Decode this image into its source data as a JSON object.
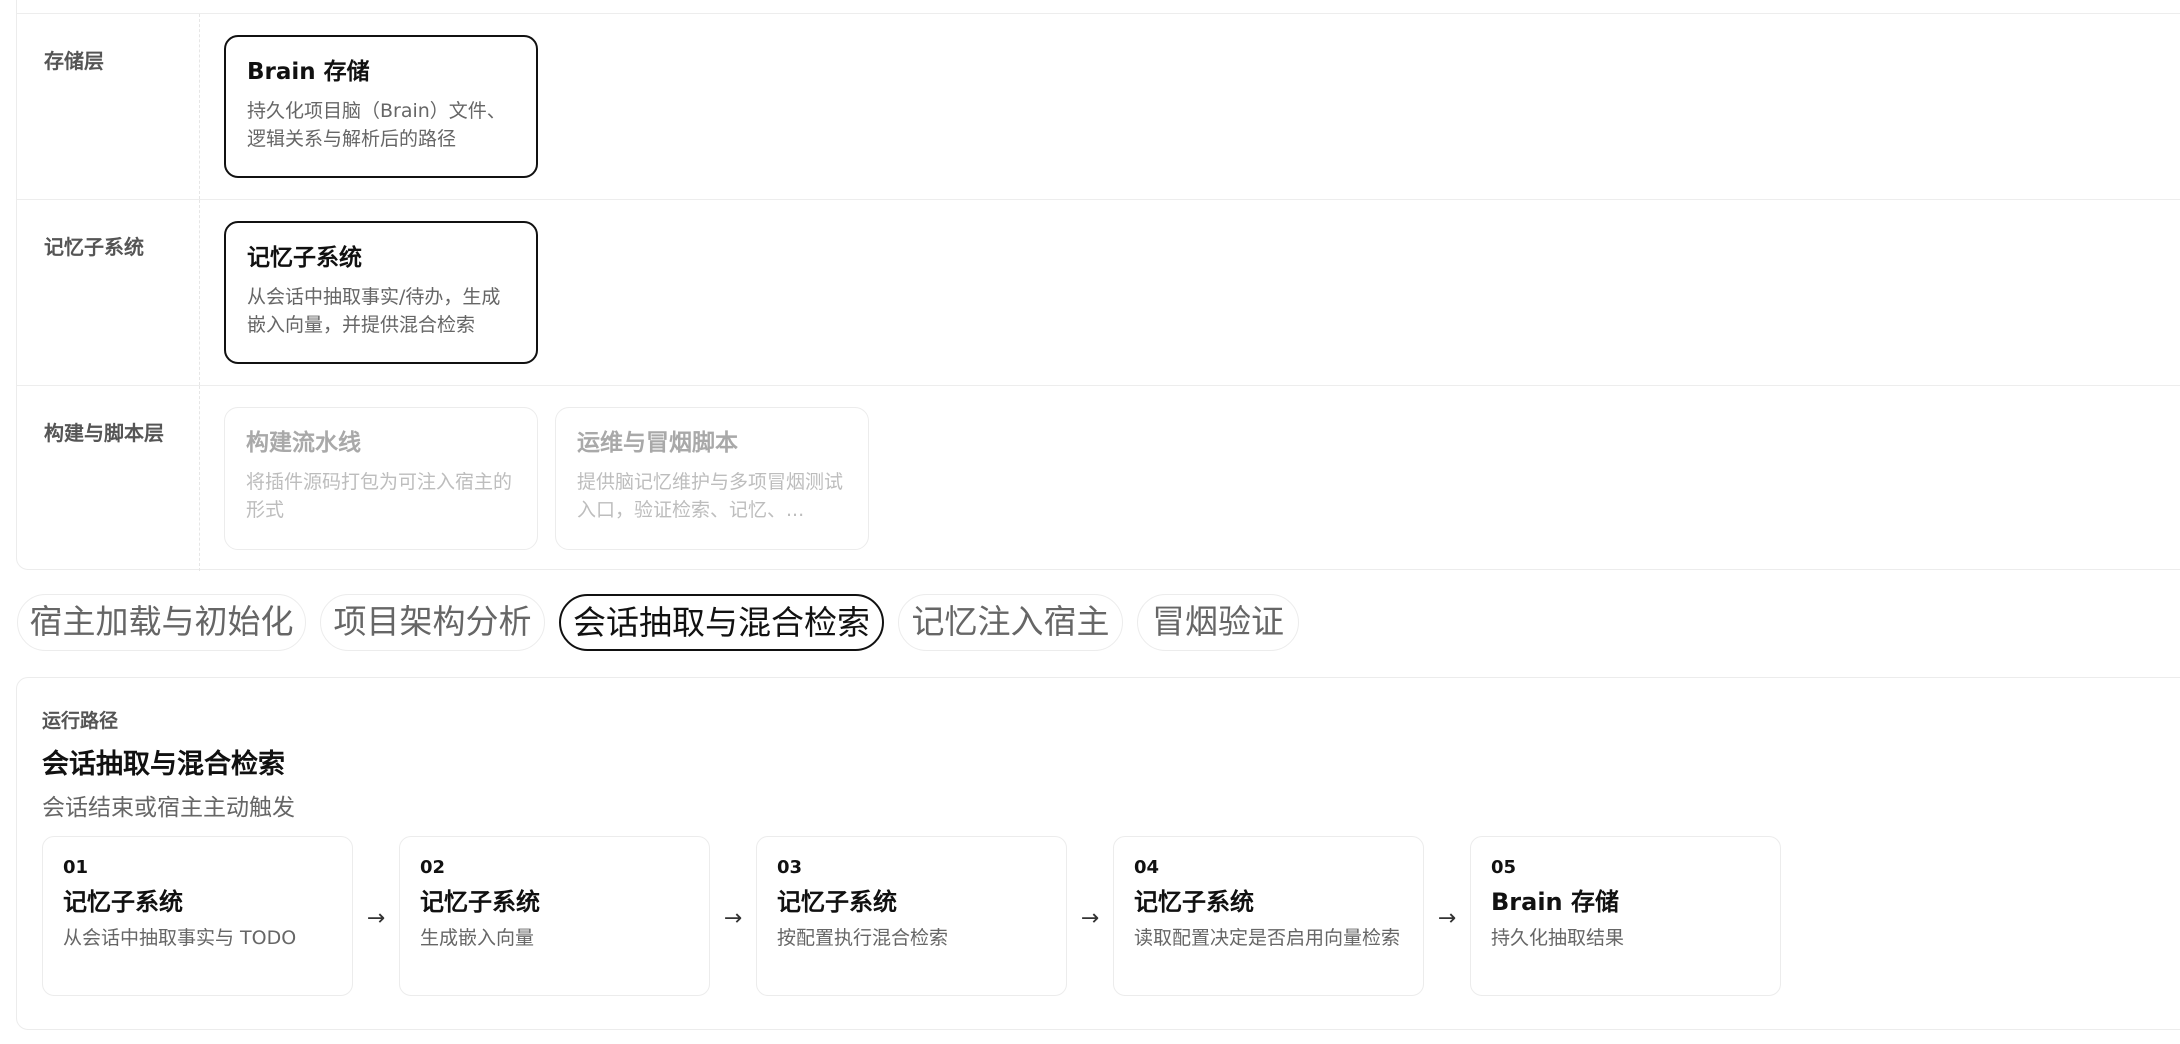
{
  "layers": [
    {
      "label": "存储层",
      "cards": [
        {
          "title": "Brain 存储",
          "desc": "持久化项目脑（Brain）文件、逻辑关系与解析后的路径",
          "state": "active"
        }
      ]
    },
    {
      "label": "记忆子系统",
      "cards": [
        {
          "title": "记忆子系统",
          "desc": "从会话中抽取事实/待办，生成嵌入向量，并提供混合检索",
          "state": "active"
        }
      ]
    },
    {
      "label": "构建与脚本层",
      "cards": [
        {
          "title": "构建流水线",
          "desc": "将插件源码打包为可注入宿主的形式",
          "state": "dim"
        },
        {
          "title": "运维与冒烟脚本",
          "desc": "提供脑记忆维护与多项冒烟测试入口，验证检索、记忆、...",
          "state": "dim"
        }
      ]
    }
  ],
  "flow_tabs": {
    "items": [
      "宿主加载与初始化",
      "项目架构分析",
      "会话抽取与混合检索",
      "记忆注入宿主",
      "冒烟验证"
    ],
    "active_index": 2
  },
  "run_path": {
    "eyebrow": "运行路径",
    "title": "会话抽取与混合检索",
    "subtitle": "会话结束或宿主主动触发",
    "arrow": "→",
    "steps": [
      {
        "num": "01",
        "title": "记忆子系统",
        "desc": "从会话中抽取事实与 TODO"
      },
      {
        "num": "02",
        "title": "记忆子系统",
        "desc": "生成嵌入向量"
      },
      {
        "num": "03",
        "title": "记忆子系统",
        "desc": "按配置执行混合检索"
      },
      {
        "num": "04",
        "title": "记忆子系统",
        "desc": "读取配置决定是否启用向量检索"
      },
      {
        "num": "05",
        "title": "Brain 存储",
        "desc": "持久化抽取结果"
      }
    ]
  }
}
